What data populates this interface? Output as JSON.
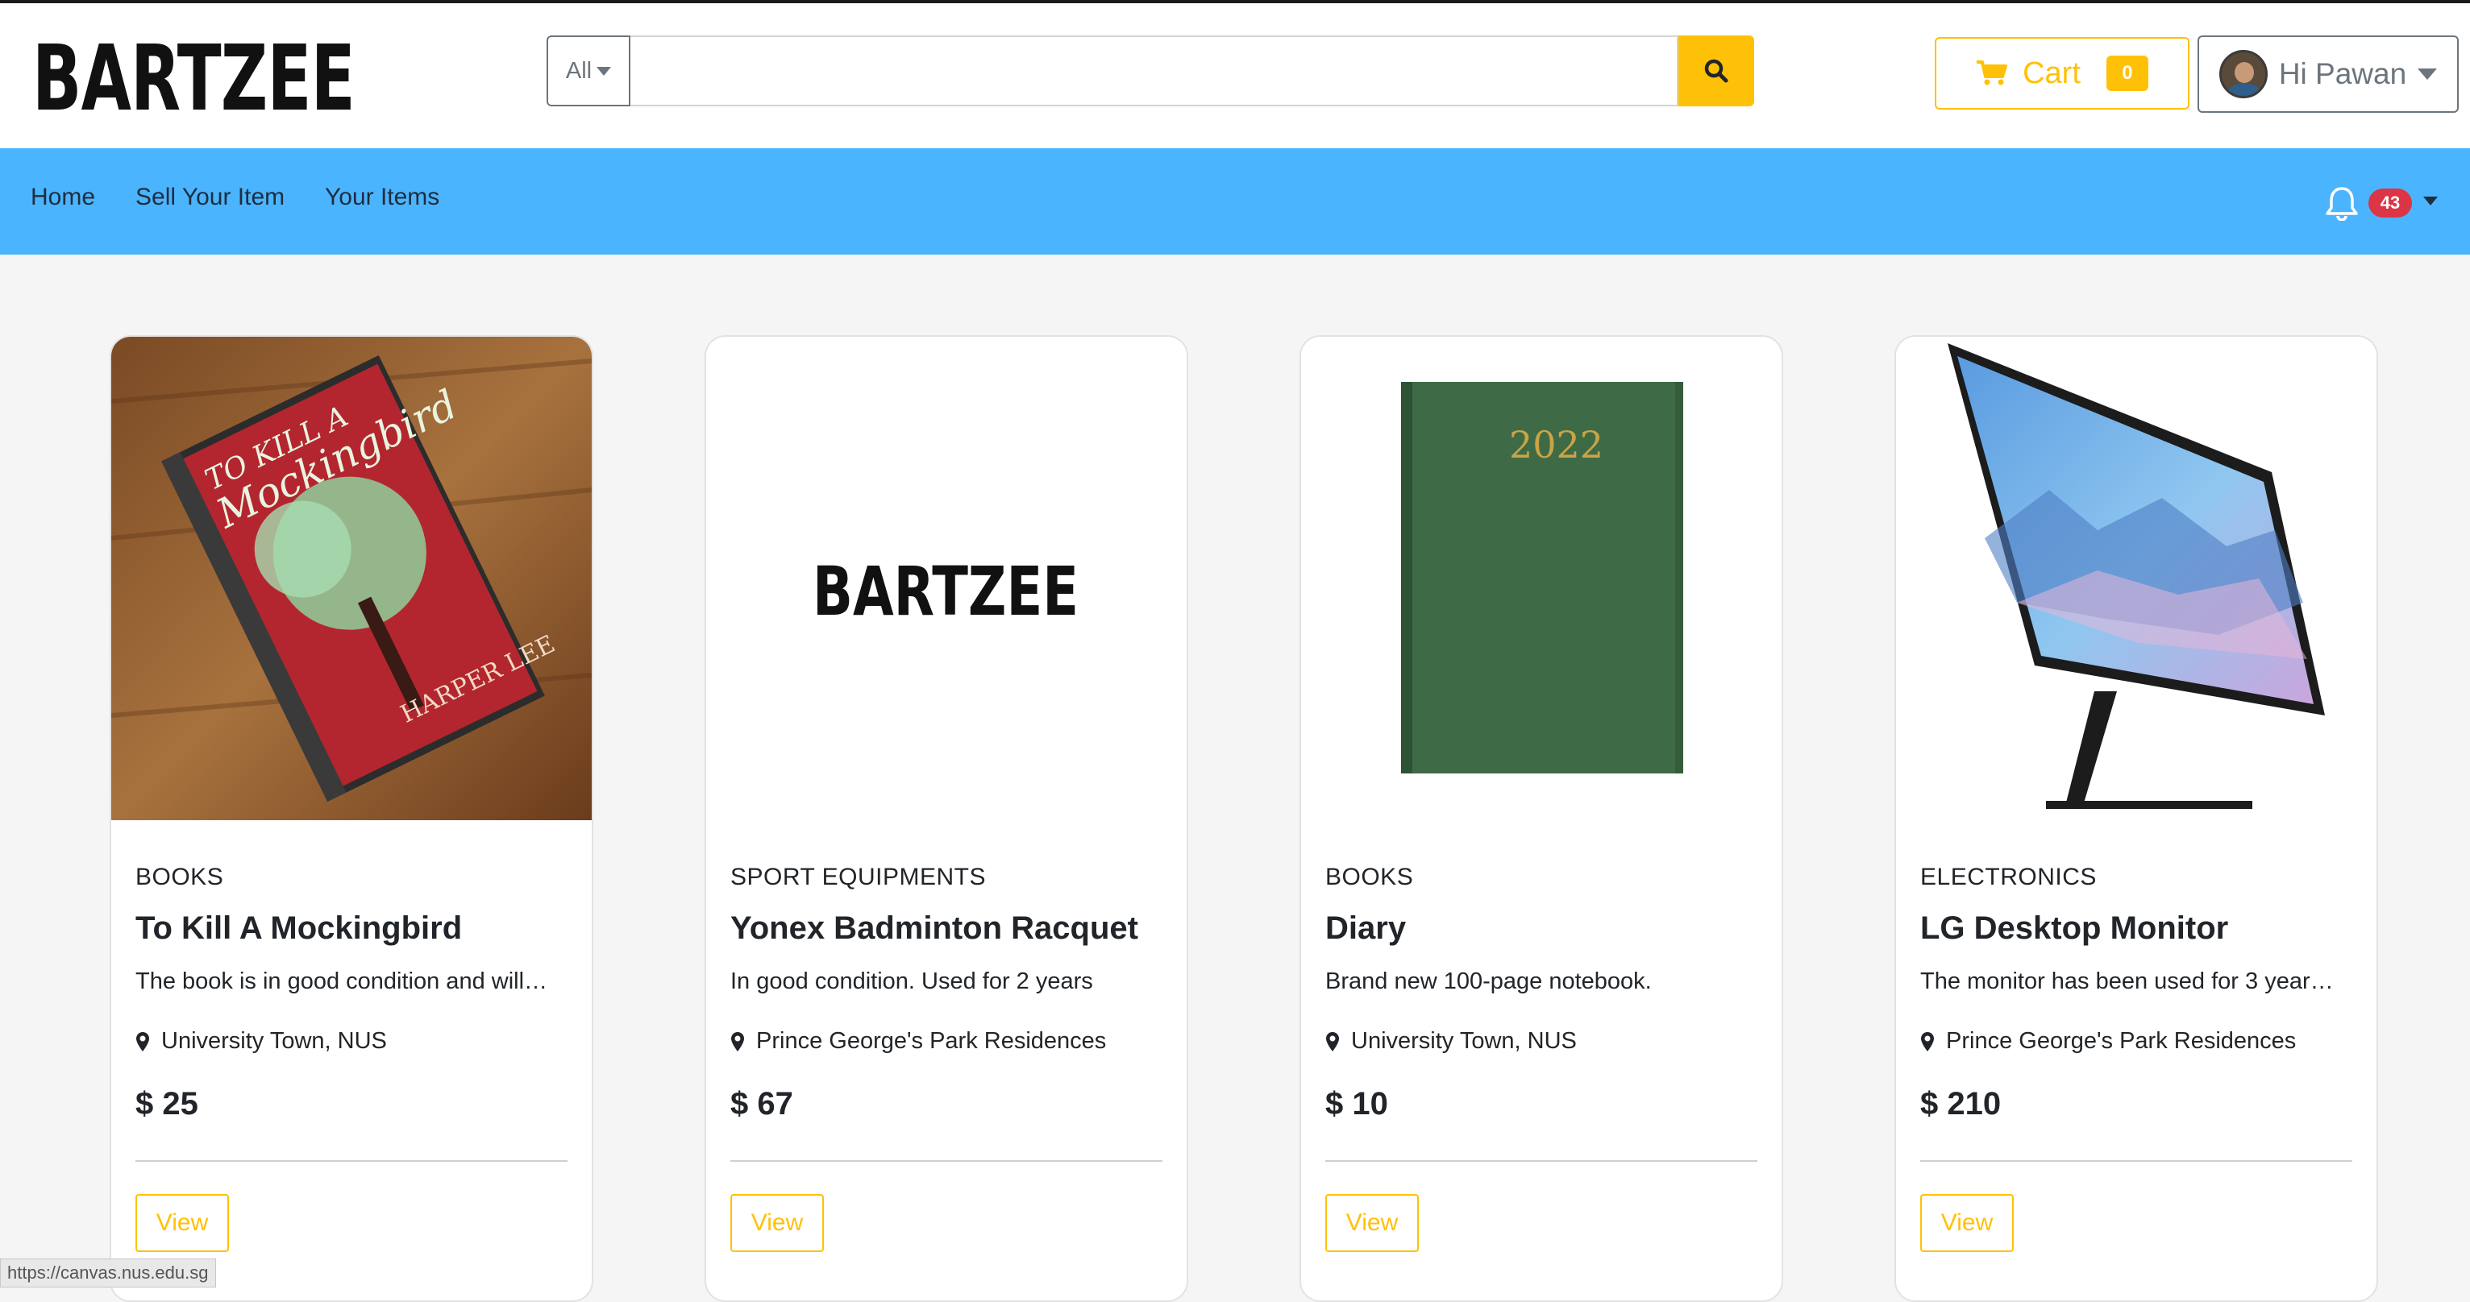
{
  "brand": {
    "logo": "BARTZEE",
    "accent": "#ffc107",
    "nav_bg": "#4bb4ff"
  },
  "search": {
    "category": "All",
    "value": "",
    "placeholder": "",
    "button_icon": "search-icon"
  },
  "cart": {
    "label": "Cart",
    "count": "0",
    "icon": "shopping-cart-icon"
  },
  "user": {
    "greeting": "Hi Pawan"
  },
  "nav": {
    "links": [
      "Home",
      "Sell Your Item",
      "Your Items"
    ],
    "notifications": "43"
  },
  "listings": [
    {
      "category": "BOOKS",
      "title": "To Kill A Mockingbird",
      "description": "The book is in good condition and will…",
      "location": "University Town, NUS",
      "price": "$ 25",
      "action": "View",
      "image": "book-cover-photo"
    },
    {
      "category": "SPORT EQUIPMENTS",
      "title": "Yonex Badminton Racquet",
      "description": "In good condition. Used for 2 years",
      "location": "Prince George's Park Residences",
      "price": "$ 67",
      "action": "View",
      "image": "bartzee-placeholder",
      "image_text": "BARTZEE"
    },
    {
      "category": "BOOKS",
      "title": "Diary",
      "description": "Brand new 100-page notebook.",
      "location": "University Town, NUS",
      "price": "$ 10",
      "action": "View",
      "image": "green-diary-photo",
      "image_text": "2022"
    },
    {
      "category": "ELECTRONICS",
      "title": "LG Desktop Monitor",
      "description": "The monitor has been used for 3 year…",
      "location": "Prince George's Park Residences",
      "price": "$ 210",
      "action": "View",
      "image": "monitor-photo"
    }
  ],
  "status_bar": {
    "url": "https://canvas.nus.edu.sg"
  }
}
